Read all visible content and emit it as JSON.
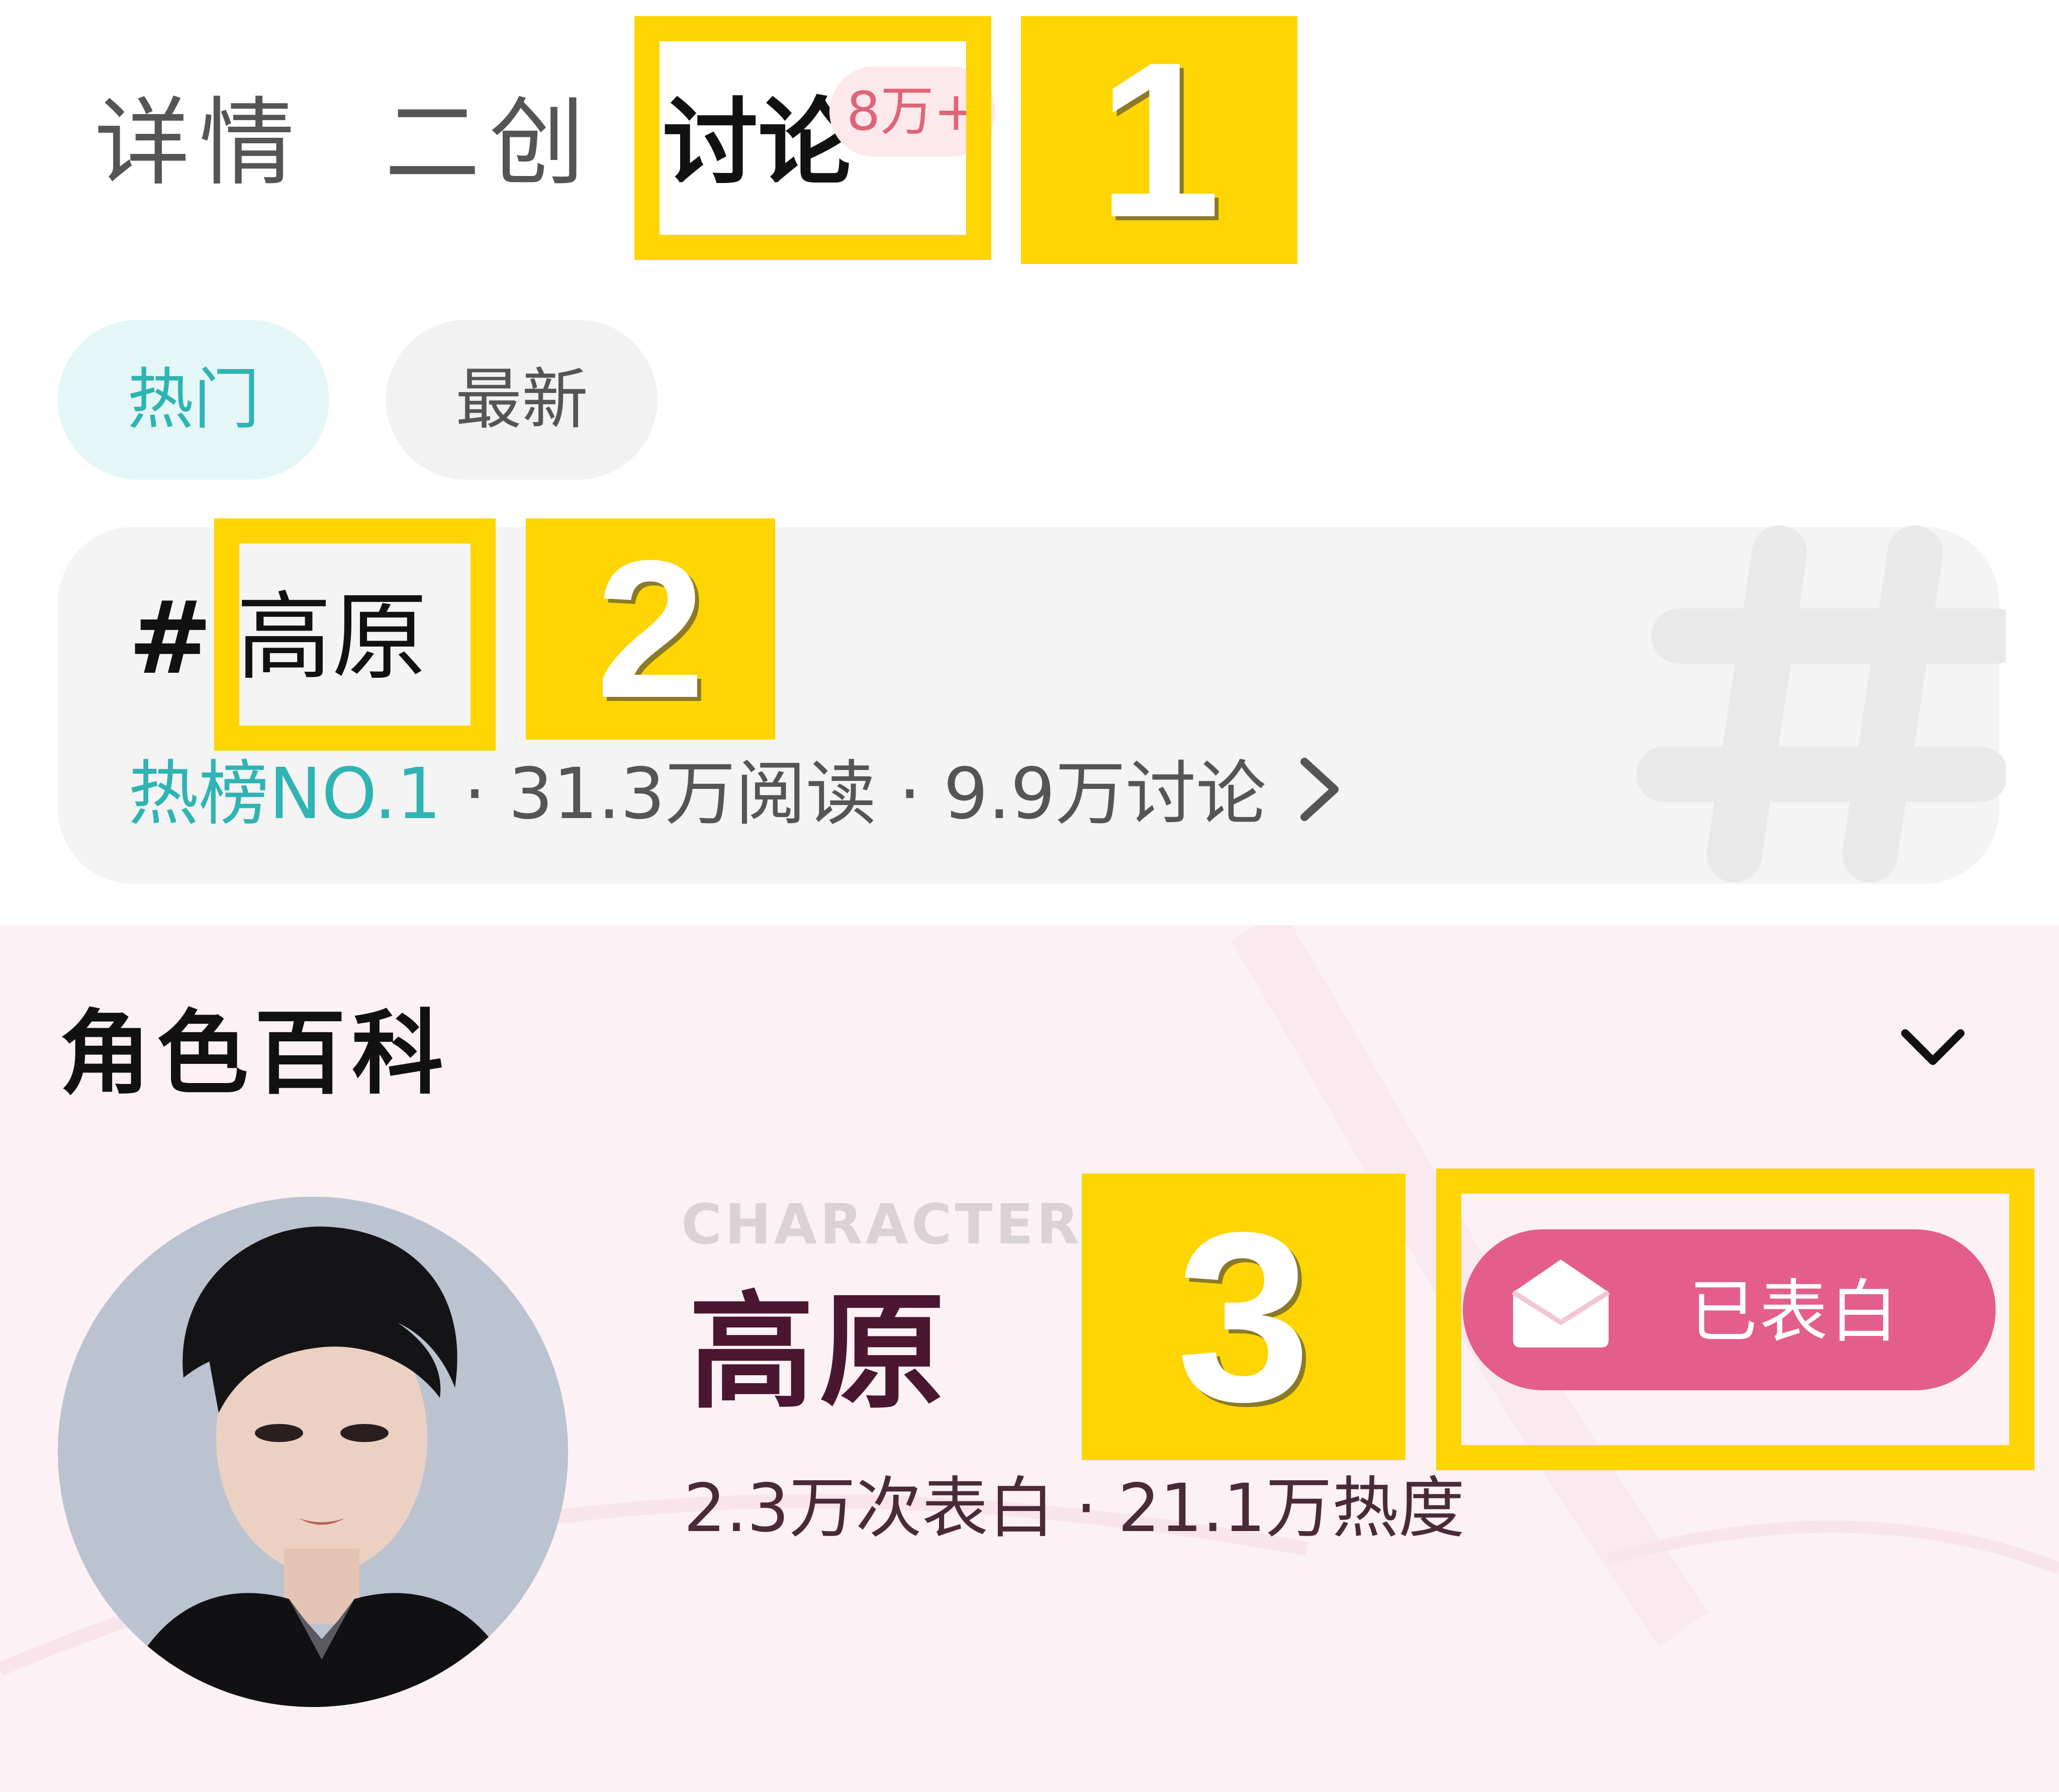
{
  "tabs": [
    {
      "label": "详情",
      "active": false
    },
    {
      "label": "二创",
      "active": false
    },
    {
      "label": "讨论",
      "active": true,
      "badge": "8万+"
    }
  ],
  "filters": [
    {
      "label": "热门",
      "active": true
    },
    {
      "label": "最新",
      "active": false
    }
  ],
  "topic": {
    "hash": "#",
    "title": "高原",
    "rank": "热榜NO.1",
    "reads": "31.3万阅读",
    "discussions": "9.9万讨论",
    "separator": " · "
  },
  "wiki": {
    "title": "角色百科",
    "character_label": "CHARACTER",
    "character_name": "高原",
    "confessions": "2.3万次表白",
    "heat": "21.1万热度",
    "separator": " · ",
    "button_label": "已表白"
  },
  "annotations": [
    "1",
    "2",
    "3"
  ],
  "colors": {
    "accent_teal": "#2fb4b3",
    "button_pink": "#e45e8b",
    "badge_red": "#e06478",
    "annotation_yellow": "#fed500"
  },
  "icons": [
    "chevron-right-icon",
    "chevron-down-icon",
    "envelope-icon",
    "hash-watermark-icon"
  ]
}
